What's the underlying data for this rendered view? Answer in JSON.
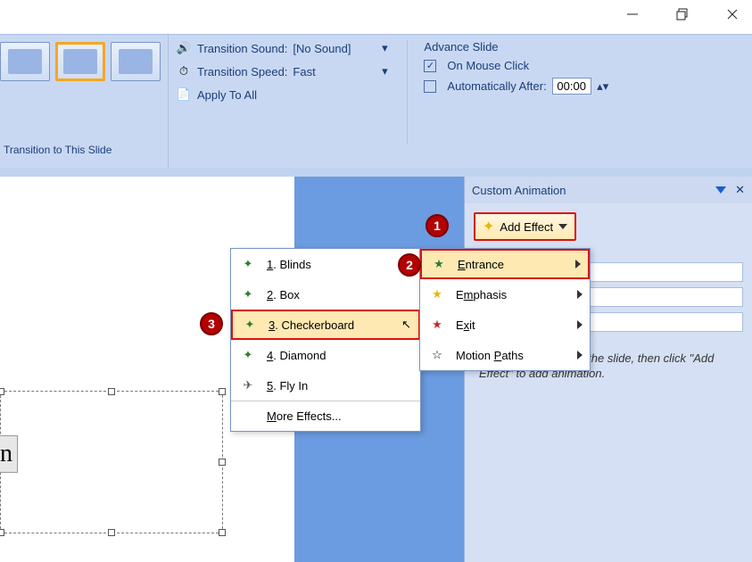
{
  "window": {
    "minimize": "min",
    "restore": "restore",
    "close": "close"
  },
  "ribbon": {
    "gallery_caption": "Transition to This Slide",
    "transition_sound_label": "Transition Sound:",
    "transition_sound_value": "[No Sound]",
    "transition_speed_label": "Transition Speed:",
    "transition_speed_value": "Fast",
    "apply_all": "Apply To All",
    "advance_slide": "Advance Slide",
    "on_mouse_click": "On Mouse Click",
    "auto_after_label": "Automatically After:",
    "auto_after_value": "00:00"
  },
  "taskpane": {
    "title": "Custom Animation",
    "add_effect": "Add Effect",
    "hint": "Select an element of the slide, then click \"Add Effect\" to add animation."
  },
  "catmenu": {
    "entrance": "Entrance",
    "emphasis": "Emphasis",
    "exit": "Exit",
    "motion_paths": "Motion Paths"
  },
  "submenu": {
    "blinds": "1. Blinds",
    "box": "2. Box",
    "checkerboard": "3. Checkerboard",
    "diamond": "4. Diamond",
    "flyin": "5. Fly In",
    "more": "More Effects..."
  },
  "badges": {
    "1": "1",
    "2": "2",
    "3": "3"
  }
}
